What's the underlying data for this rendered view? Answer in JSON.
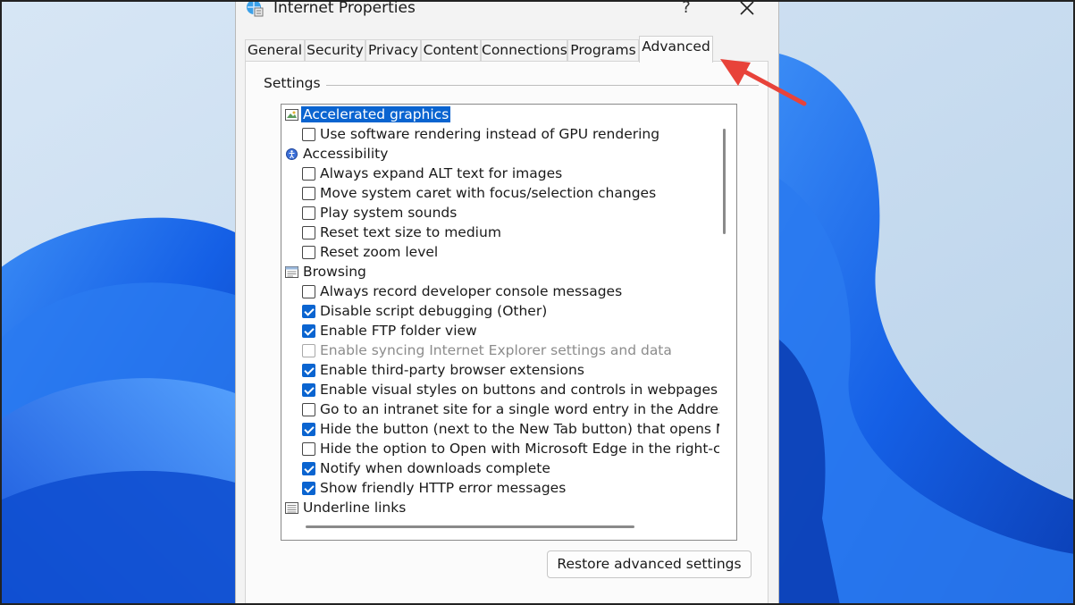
{
  "window": {
    "title": "Internet Properties",
    "help_label": "?",
    "close_icon": "close-icon"
  },
  "tabs": [
    {
      "label": "General"
    },
    {
      "label": "Security"
    },
    {
      "label": "Privacy"
    },
    {
      "label": "Content"
    },
    {
      "label": "Connections"
    },
    {
      "label": "Programs"
    },
    {
      "label": "Advanced",
      "active": true
    }
  ],
  "settings": {
    "group_label": "Settings",
    "items": [
      {
        "kind": "category",
        "icon": "graphics-icon",
        "label": "Accelerated graphics",
        "selected": true
      },
      {
        "kind": "option",
        "label": "Use software rendering instead of GPU rendering",
        "checked": false
      },
      {
        "kind": "category",
        "icon": "accessibility-icon",
        "label": "Accessibility"
      },
      {
        "kind": "option",
        "label": "Always expand ALT text for images",
        "checked": false
      },
      {
        "kind": "option",
        "label": "Move system caret with focus/selection changes",
        "checked": false
      },
      {
        "kind": "option",
        "label": "Play system sounds",
        "checked": false
      },
      {
        "kind": "option",
        "label": "Reset text size to medium",
        "checked": false
      },
      {
        "kind": "option",
        "label": "Reset zoom level",
        "checked": false
      },
      {
        "kind": "category",
        "icon": "browsing-icon",
        "label": "Browsing"
      },
      {
        "kind": "option",
        "label": "Always record developer console messages",
        "checked": false
      },
      {
        "kind": "option",
        "label": "Disable script debugging (Other)",
        "checked": true
      },
      {
        "kind": "option",
        "label": "Enable FTP folder view",
        "checked": true
      },
      {
        "kind": "option",
        "label": "Enable syncing Internet Explorer settings and data",
        "checked": false,
        "disabled": true
      },
      {
        "kind": "option",
        "label": "Enable third-party browser extensions",
        "checked": true
      },
      {
        "kind": "option",
        "label": "Enable visual styles on buttons and controls in webpages",
        "checked": true
      },
      {
        "kind": "option",
        "label": "Go to an intranet site for a single word entry in the Address ba",
        "checked": false
      },
      {
        "kind": "option",
        "label": "Hide the button (next to the New Tab button) that opens Micro",
        "checked": true
      },
      {
        "kind": "option",
        "label": "Hide the option to Open with Microsoft Edge in the right-click",
        "checked": false
      },
      {
        "kind": "option",
        "label": "Notify when downloads complete",
        "checked": true
      },
      {
        "kind": "option",
        "label": "Show friendly HTTP error messages",
        "checked": true
      },
      {
        "kind": "category",
        "icon": "underline-icon",
        "label": "Underline links"
      }
    ]
  },
  "restore_button": "Restore advanced settings",
  "colors": {
    "accent": "#0a64d0",
    "annotation_arrow": "#e8433a"
  }
}
